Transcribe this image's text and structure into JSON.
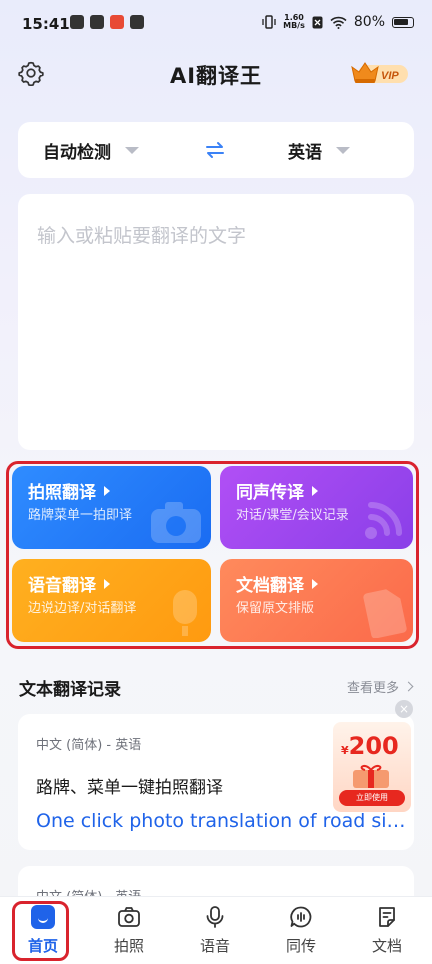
{
  "status_bar": {
    "time": "15:41",
    "speed_value": "1.60",
    "speed_unit": "MB/s",
    "battery": "80%"
  },
  "header": {
    "title": "AI翻译王",
    "vip_label": "VIP"
  },
  "language_bar": {
    "source": "自动检测",
    "target": "英语"
  },
  "input": {
    "placeholder": "输入或粘贴要翻译的文字"
  },
  "features": [
    {
      "title": "拍照翻译",
      "subtitle": "路牌菜单一拍即译"
    },
    {
      "title": "同声传译",
      "subtitle": "对话/课堂/会议记录"
    },
    {
      "title": "语音翻译",
      "subtitle": "边说边译/对话翻译"
    },
    {
      "title": "文档翻译",
      "subtitle": "保留原文排版"
    }
  ],
  "history": {
    "title": "文本翻译记录",
    "more": "查看更多",
    "records": [
      {
        "lang": "中文 (简体) - 英语",
        "source": "路牌、菜单一键拍照翻译",
        "target": "One click photo translation of road si…"
      },
      {
        "lang": "中文 (简体) - 英语"
      }
    ]
  },
  "ad": {
    "currency": "¥",
    "amount": "200",
    "button": "立即使用"
  },
  "tabs": [
    {
      "label": "首页",
      "icon": "home-icon",
      "active": true
    },
    {
      "label": "拍照",
      "icon": "camera-icon"
    },
    {
      "label": "语音",
      "icon": "microphone-icon"
    },
    {
      "label": "同传",
      "icon": "simultaneous-icon"
    },
    {
      "label": "文档",
      "icon": "document-icon"
    }
  ],
  "colors": {
    "accent": "#1f63e9",
    "highlight": "#d9232d"
  }
}
